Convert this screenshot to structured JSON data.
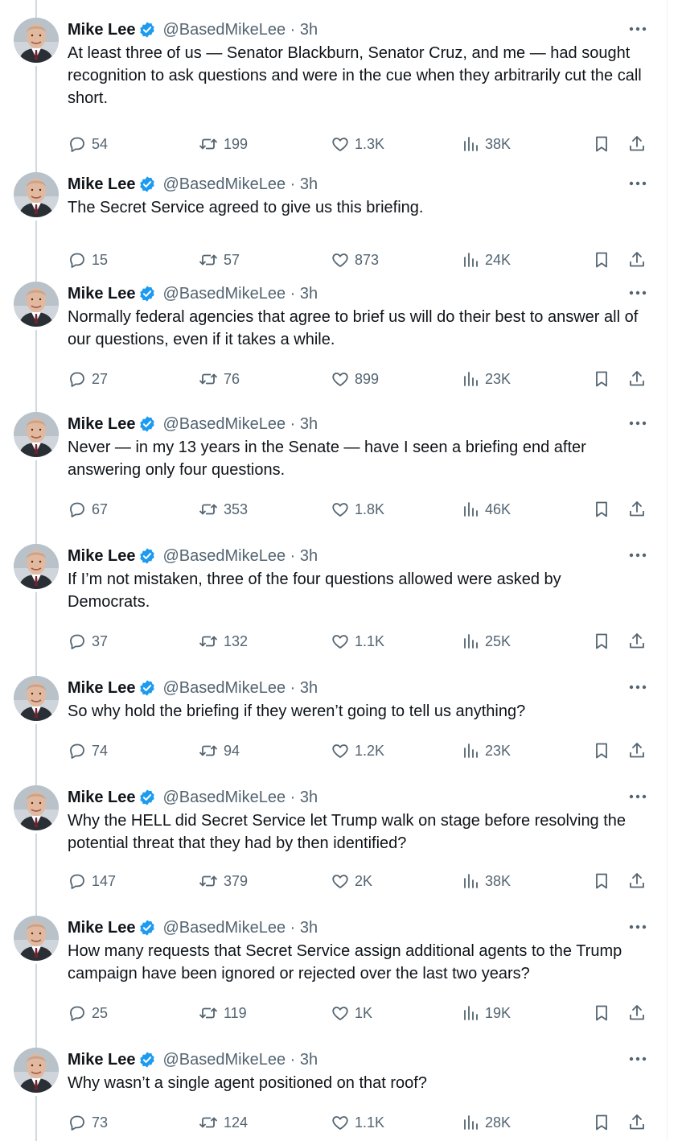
{
  "icons": {
    "verified": "verified-badge-icon",
    "more": "more-options-icon",
    "reply": "reply-icon",
    "retweet": "retweet-icon",
    "like": "like-icon",
    "views": "views-icon",
    "bookmark": "bookmark-icon",
    "share": "share-icon"
  },
  "colors": {
    "verified": "#1d9bf0",
    "text": "#0f1419",
    "muted": "#536471",
    "thread_line": "#cfd9de"
  },
  "tweets": [
    {
      "name": "Mike Lee",
      "handle_time": "@BasedMikeLee · 3h",
      "text": "At least three of us — Senator Blackburn, Senator Cruz, and me — had sought recognition to ask questions and were in the cue when they arbitrarily cut the call short.",
      "replies": "54",
      "retweets": "199",
      "likes": "1.3K",
      "views": "38K"
    },
    {
      "name": "Mike Lee",
      "handle_time": "@BasedMikeLee · 3h",
      "text": "The Secret Service agreed to give us this briefing.",
      "replies": "15",
      "retweets": "57",
      "likes": "873",
      "views": "24K"
    },
    {
      "name": "Mike Lee",
      "handle_time": "@BasedMikeLee · 3h",
      "text": "Normally federal agencies that agree to brief us will do their best to answer all of our questions, even if it takes a while.",
      "replies": "27",
      "retweets": "76",
      "likes": "899",
      "views": "23K"
    },
    {
      "name": "Mike Lee",
      "handle_time": "@BasedMikeLee · 3h",
      "text": "Never — in my 13 years in the Senate — have I seen a briefing end after answering only four questions.",
      "replies": "67",
      "retweets": "353",
      "likes": "1.8K",
      "views": "46K"
    },
    {
      "name": "Mike Lee",
      "handle_time": "@BasedMikeLee · 3h",
      "text": "If I’m not mistaken, three of the four questions allowed were asked by Democrats.",
      "replies": "37",
      "retweets": "132",
      "likes": "1.1K",
      "views": "25K"
    },
    {
      "name": "Mike Lee",
      "handle_time": "@BasedMikeLee · 3h",
      "text": "So why hold the briefing if they weren’t going to tell us anything?",
      "replies": "74",
      "retweets": "94",
      "likes": "1.2K",
      "views": "23K"
    },
    {
      "name": "Mike Lee",
      "handle_time": "@BasedMikeLee · 3h",
      "text": "Why the HELL did Secret Service let Trump walk on stage before resolving the potential threat that they had by then identified?",
      "replies": "147",
      "retweets": "379",
      "likes": "2K",
      "views": "38K"
    },
    {
      "name": "Mike Lee",
      "handle_time": "@BasedMikeLee · 3h",
      "text": "How many requests that Secret Service assign additional agents to the Trump campaign have been ignored or rejected over the last two years?",
      "replies": "25",
      "retweets": "119",
      "likes": "1K",
      "views": "19K"
    },
    {
      "name": "Mike Lee",
      "handle_time": "@BasedMikeLee · 3h",
      "text": "Why wasn’t a single agent positioned on that roof?",
      "replies": "73",
      "retweets": "124",
      "likes": "1.1K",
      "views": "28K"
    }
  ]
}
